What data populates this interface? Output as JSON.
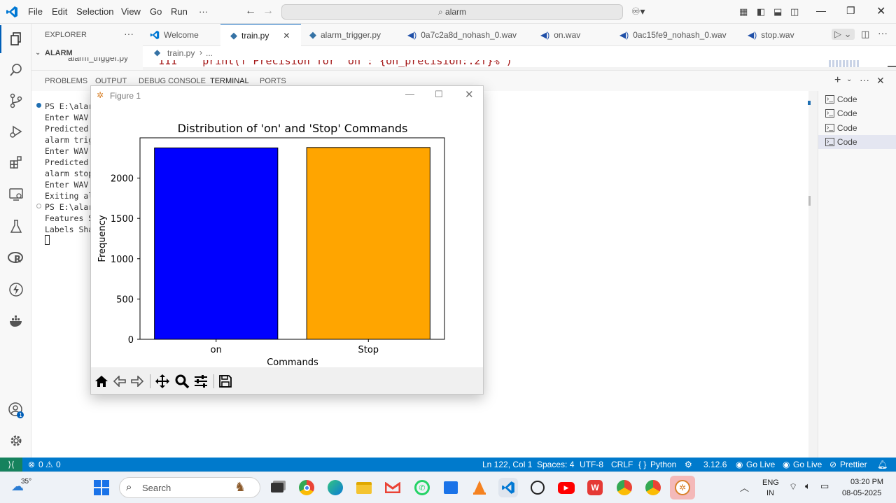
{
  "titlebar": {
    "menu": [
      "File",
      "Edit",
      "Selection",
      "View",
      "Go",
      "Run",
      "···"
    ],
    "search_text": "alarm"
  },
  "sidebar": {
    "explorer_label": "EXPLORER",
    "folder_label": "ALARM",
    "file_partial": "alarm_trigger.py"
  },
  "tabs": [
    {
      "label": "Welcome",
      "icon": "vscode-icon"
    },
    {
      "label": "train.py",
      "icon": "python-icon"
    },
    {
      "label": "alarm_trigger.py",
      "icon": "python-icon"
    },
    {
      "label": "0a7c2a8d_nohash_0.wav",
      "icon": "audio-icon"
    },
    {
      "label": "on.wav",
      "icon": "audio-icon"
    },
    {
      "label": "0ac15fe9_nohash_0.wav",
      "icon": "audio-icon"
    },
    {
      "label": "stop.wav",
      "icon": "audio-icon"
    }
  ],
  "breadcrumb": {
    "file": "train.py",
    "rest": "..."
  },
  "editor": {
    "code_line": "111    print(f\"Precision for 'on': {on_precision:.2f}%\")"
  },
  "panel": {
    "tabs": [
      "PROBLEMS",
      "OUTPUT",
      "DEBUG CONSOLE",
      "TERMINAL",
      "PORTS"
    ],
    "terminal_lines": [
      "PS E:\\alar",
      "Enter WAV",
      "Predicted",
      "alarm trig",
      "Enter WAV",
      "Predicted",
      "alarm stop",
      "Enter WAV",
      "Exiting al",
      "PS E:\\alar",
      "Features S",
      "Labels Sha"
    ],
    "terminal_instances": [
      "Code",
      "Code",
      "Code",
      "Code"
    ]
  },
  "figure": {
    "window_title": "Figure 1"
  },
  "chart_data": {
    "type": "bar",
    "title": "Distribution of 'on' and 'Stop' Commands",
    "xlabel": "Commands",
    "ylabel": "Frequency",
    "categories": [
      "on",
      "Stop"
    ],
    "values": [
      2375,
      2380
    ],
    "colors": [
      "#0000ff",
      "#ffa500"
    ],
    "ylim": [
      0,
      2500
    ],
    "yticks": [
      0,
      500,
      1000,
      1500,
      2000
    ],
    "grid": false
  },
  "statusbar": {
    "errors": "0",
    "warnings": "0",
    "position": "Ln 122, Col 1",
    "spaces": "Spaces: 4",
    "encoding": "UTF-8",
    "eol": "CRLF",
    "language": "Python",
    "python_version": "3.12.6",
    "golive1": "Go Live",
    "golive2": "Go Live",
    "prettier": "Prettier"
  },
  "taskbar": {
    "weather_temp": "35°",
    "search_placeholder": "Search",
    "lang_top": "ENG",
    "lang_bottom": "IN",
    "time": "03:20 PM",
    "date": "08-05-2025"
  },
  "colors": {
    "accent": "#007acc",
    "bar_on": "#0000ff",
    "bar_stop": "#ffa500"
  }
}
